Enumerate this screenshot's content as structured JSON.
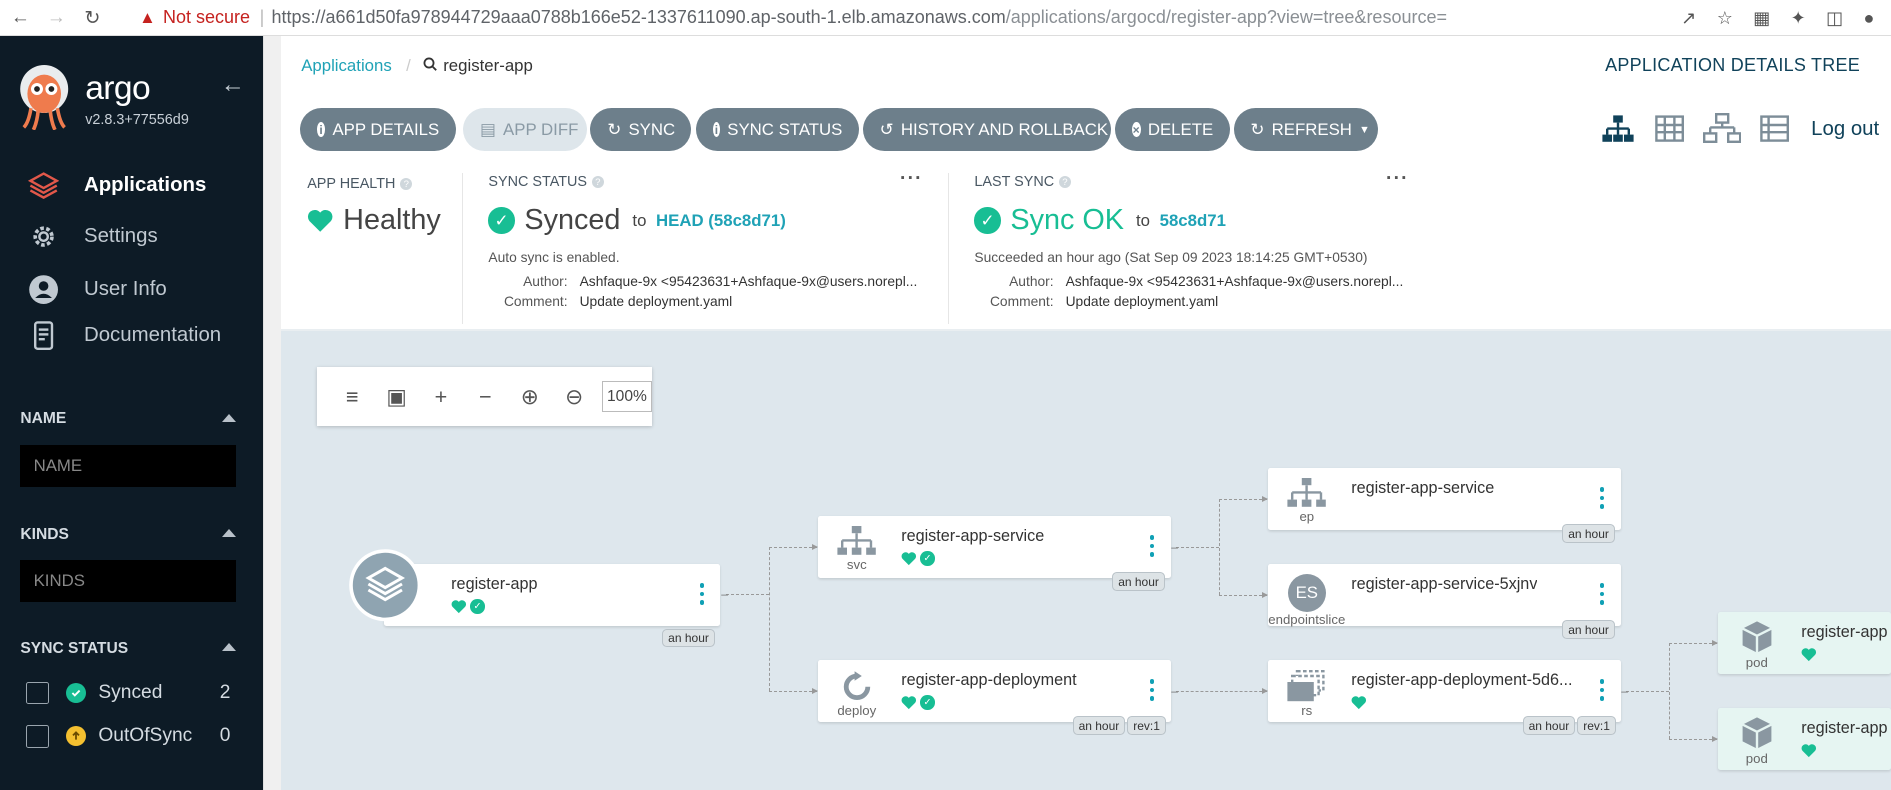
{
  "browser": {
    "back_icon": "arrow-left-icon",
    "forward_icon": "arrow-right-icon",
    "reload_icon": "reload-icon",
    "not_secure": "Not secure",
    "url_host": "https://a661d50fa978944729aaa0788b166e52-1337611090.ap-south-1.elb.amazonaws.com",
    "url_path": "/applications/argocd/register-app?view=tree&resource="
  },
  "sidebar": {
    "brand": "argo",
    "version": "v2.8.3+77556d9",
    "nav": [
      {
        "label": "Applications",
        "icon": "layers-icon",
        "active": true
      },
      {
        "label": "Settings",
        "icon": "gear-icon",
        "active": false
      },
      {
        "label": "User Info",
        "icon": "user-icon",
        "active": false
      },
      {
        "label": "Documentation",
        "icon": "doc-icon",
        "active": false
      }
    ],
    "filters": {
      "name_title": "NAME",
      "name_placeholder": "NAME",
      "kinds_title": "KINDS",
      "kinds_placeholder": "KINDS",
      "sync_title": "SYNC STATUS",
      "sync_items": [
        {
          "label": "Synced",
          "count": "2",
          "color": "#18be94"
        },
        {
          "label": "OutOfSync",
          "count": "0",
          "color": "#f4c030"
        }
      ]
    }
  },
  "breadcrumb": {
    "root": "Applications",
    "current": "register-app"
  },
  "view_title": "APPLICATION DETAILS TREE",
  "toolbar": {
    "app_details": "APP DETAILS",
    "app_diff": "APP DIFF",
    "sync": "SYNC",
    "sync_status": "SYNC STATUS",
    "history": "HISTORY AND ROLLBACK",
    "delete": "DELETE",
    "refresh": "REFRESH",
    "logout": "Log out"
  },
  "status": {
    "health_title": "APP HEALTH",
    "health_value": "Healthy",
    "sync_title": "SYNC STATUS",
    "sync_value": "Synced",
    "sync_to": "to",
    "sync_rev": "HEAD (58c8d71)",
    "auto_sync": "Auto sync is enabled.",
    "author_label": "Author:",
    "author_value": "Ashfaque-9x <95423631+Ashfaque-9x@users.norepl...",
    "comment_label": "Comment:",
    "comment_value": "Update deployment.yaml",
    "last_title": "LAST SYNC",
    "last_value": "Sync OK",
    "last_to": "to",
    "last_rev": "58c8d71",
    "last_time": "Succeeded an hour ago (Sat Sep 09 2023 18:14:25 GMT+0530)",
    "last_author_label": "Author:",
    "last_author_value": "Ashfaque-9x <95423631+Ashfaque-9x@users.norepl...",
    "last_comment_label": "Comment:",
    "last_comment_value": "Update deployment.yaml",
    "colors": {
      "healthy": "#18be94",
      "link": "#1fa2b6"
    }
  },
  "zoom": {
    "value": "100%"
  },
  "nodes": {
    "app": {
      "name": "register-app",
      "age": "an hour"
    },
    "svc": {
      "name": "register-app-service",
      "kind": "svc",
      "age": "an hour"
    },
    "deploy": {
      "name": "register-app-deployment",
      "kind": "deploy",
      "age": "an hour",
      "rev": "rev:1"
    },
    "ep": {
      "name": "register-app-service",
      "kind": "ep",
      "age": "an hour"
    },
    "eps": {
      "name": "register-app-service-5xjnv",
      "kind": "endpointslice",
      "glyph": "ES",
      "age": "an hour"
    },
    "rs": {
      "name": "register-app-deployment-5d6...",
      "kind": "rs",
      "age": "an hour",
      "rev": "rev:1"
    },
    "pod1": {
      "name": "register-app",
      "kind": "pod"
    },
    "pod2": {
      "name": "register-app",
      "kind": "pod"
    }
  }
}
